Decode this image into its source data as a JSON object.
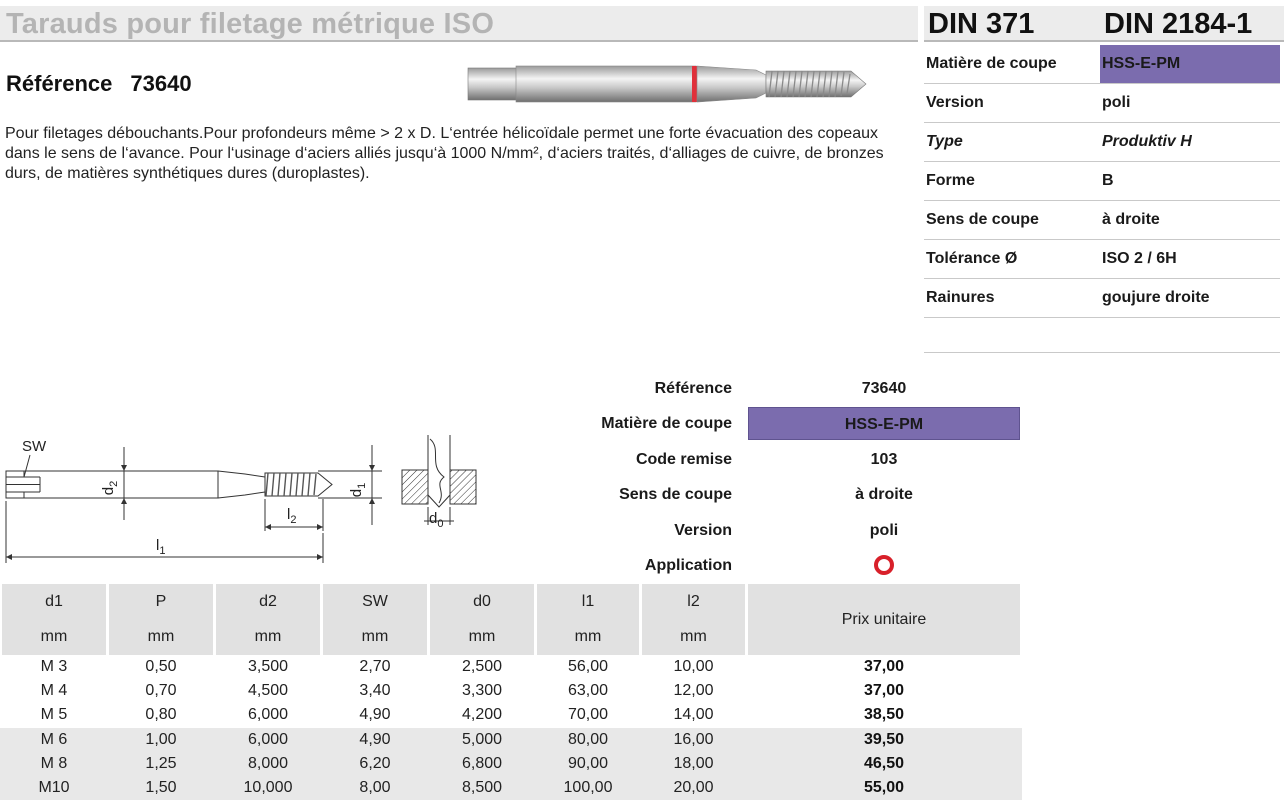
{
  "header": {
    "title": "Tarauds pour filetage métrique ISO",
    "din_a": "DIN 371",
    "din_b": "DIN 2184-1"
  },
  "reference": {
    "label": "Référence",
    "value": "73640"
  },
  "description": "Pour filetages débouchants.Pour profondeurs même > 2 x D. L‘entrée hélicoïdale permet une forte évacuation des copeaux dans le sens de l‘avance. Pour l‘usinage d‘aciers alliés jusqu‘à 1000 N/mm², d‘aciers traités, d‘alliages de cuivre, de bronzes durs, de matières synthétiques dures (duroplastes).",
  "specs": [
    {
      "label": "Matière de coupe",
      "value": "HSS-E-PM",
      "highlight": true,
      "italic": false
    },
    {
      "label": "Version",
      "value": "poli",
      "highlight": false,
      "italic": false
    },
    {
      "label": "Type",
      "value": "Produktiv H",
      "highlight": false,
      "italic": true
    },
    {
      "label": "Forme",
      "value": "B",
      "highlight": false,
      "italic": false
    },
    {
      "label": "Sens de coupe",
      "value": "à droite",
      "highlight": false,
      "italic": false
    },
    {
      "label": "Tolérance Ø",
      "value": "ISO 2 / 6H",
      "highlight": false,
      "italic": false
    },
    {
      "label": "Rainures",
      "value": "goujure droite",
      "highlight": false,
      "italic": false
    }
  ],
  "summary": [
    {
      "label": "Référence",
      "value": "73640",
      "highlight": false
    },
    {
      "label": "Matière de coupe",
      "value": "HSS-E-PM",
      "highlight": true
    },
    {
      "label": "Code remise",
      "value": "103",
      "highlight": false
    },
    {
      "label": "Sens de coupe",
      "value": "à droite",
      "highlight": false
    },
    {
      "label": "Version",
      "value": "poli",
      "highlight": false
    },
    {
      "label": "Application",
      "value": "",
      "icon": "red-ring-icon",
      "highlight": false
    }
  ],
  "drawing_labels": {
    "sw": "SW",
    "d2": "d2",
    "d1": "d1",
    "l1": "l1",
    "l2": "l2",
    "d0": "d0"
  },
  "table": {
    "headers": [
      {
        "name": "d1",
        "unit": "mm"
      },
      {
        "name": "P",
        "unit": "mm"
      },
      {
        "name": "d2",
        "unit": "mm"
      },
      {
        "name": "SW",
        "unit": "mm"
      },
      {
        "name": "d0",
        "unit": "mm"
      },
      {
        "name": "l1",
        "unit": "mm"
      },
      {
        "name": "l2",
        "unit": "mm"
      }
    ],
    "price_header": "Prix unitaire",
    "rows": [
      [
        "M 3",
        "0,50",
        "3,500",
        "2,70",
        "2,500",
        "56,00",
        "10,00",
        "37,00"
      ],
      [
        "M 4",
        "0,70",
        "4,500",
        "3,40",
        "3,300",
        "63,00",
        "12,00",
        "37,00"
      ],
      [
        "M 5",
        "0,80",
        "6,000",
        "4,90",
        "4,200",
        "70,00",
        "14,00",
        "38,50"
      ],
      [
        "M 6",
        "1,00",
        "6,000",
        "4,90",
        "5,000",
        "80,00",
        "16,00",
        "39,50"
      ],
      [
        "M 8",
        "1,25",
        "8,000",
        "6,20",
        "6,800",
        "90,00",
        "18,00",
        "46,50"
      ],
      [
        "M10",
        "1,50",
        "10,000",
        "8,00",
        "8,500",
        "100,00",
        "20,00",
        "55,00"
      ]
    ]
  },
  "colors": {
    "highlight": "#7b6cae",
    "application_ring": "#d8202a",
    "header_bg": "#ececec",
    "table_header_bg": "#e1e1e1"
  }
}
